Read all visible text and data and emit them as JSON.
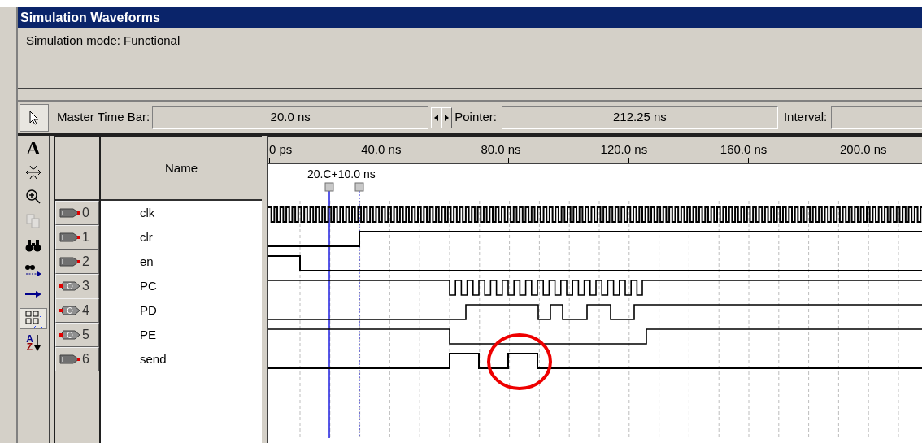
{
  "window": {
    "title": "Simulation Waveforms"
  },
  "mode": "Simulation mode: Functional",
  "timebar": {
    "master_label": "Master Time Bar:",
    "master_value": "20.0 ns",
    "pointer_label": "Pointer:",
    "pointer_value": "212.25 ns",
    "interval_label": "Interval:"
  },
  "tools": [
    {
      "kind": "pointer",
      "selected": true,
      "disabled": false
    },
    {
      "kind": "text",
      "glyph": "A",
      "selected": false,
      "disabled": false
    },
    {
      "kind": "stretch",
      "selected": false,
      "disabled": false
    },
    {
      "kind": "zoom",
      "selected": false,
      "disabled": false
    },
    {
      "kind": "copy",
      "selected": false,
      "disabled": true
    },
    {
      "kind": "find",
      "selected": false,
      "disabled": false
    },
    {
      "kind": "find-next",
      "selected": false,
      "disabled": false
    },
    {
      "kind": "arrow",
      "selected": false,
      "disabled": false
    },
    {
      "kind": "snap",
      "selected": true,
      "disabled": false
    },
    {
      "kind": "sort",
      "glyph_top": "A",
      "glyph_bottom": "Z",
      "selected": false,
      "disabled": false
    }
  ],
  "table": {
    "name_header": "Name"
  },
  "axis": {
    "labels": [
      "0 ps",
      "40.0 ns",
      "80.0 ns",
      "120.0 ns",
      "160.0 ns",
      "200.0 ns"
    ],
    "marker_label": "20.C+10.0 ns"
  },
  "signals": [
    {
      "index": "0",
      "name": "clk",
      "kind": "input"
    },
    {
      "index": "1",
      "name": "clr",
      "kind": "input"
    },
    {
      "index": "2",
      "name": "en",
      "kind": "input"
    },
    {
      "index": "3",
      "name": "PC",
      "kind": "output"
    },
    {
      "index": "4",
      "name": "PD",
      "kind": "output"
    },
    {
      "index": "5",
      "name": "PE",
      "kind": "output"
    },
    {
      "index": "6",
      "name": "send",
      "kind": "input"
    }
  ]
}
